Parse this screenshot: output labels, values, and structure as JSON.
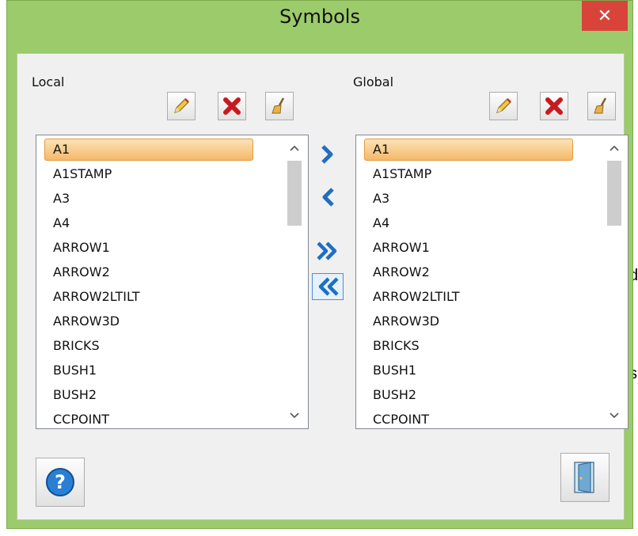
{
  "window": {
    "title": "Symbols",
    "close_glyph": "✕"
  },
  "background_fragments": {
    "line1": "d",
    "line2": "s"
  },
  "local": {
    "label": "Local",
    "toolbar": [
      "pencil-icon",
      "delete-x-icon",
      "broom-icon"
    ],
    "selected": "A1",
    "items": [
      "A1",
      "A1STAMP",
      "A3",
      "A4",
      "ARROW1",
      "ARROW2",
      "ARROW2LTILT",
      "ARROW3D",
      "BRICKS",
      "BUSH1",
      "BUSH2",
      "CCPOINT"
    ]
  },
  "global": {
    "label": "Global",
    "toolbar": [
      "pencil-icon",
      "delete-x-icon",
      "broom-icon"
    ],
    "selected": "A1",
    "items": [
      "A1",
      "A1STAMP",
      "A3",
      "A4",
      "ARROW1",
      "ARROW2",
      "ARROW2LTILT",
      "ARROW3D",
      "BRICKS",
      "BUSH1",
      "BUSH2",
      "CCPOINT"
    ]
  },
  "scrollbar": {
    "up_glyph": "^",
    "down_glyph": "v"
  },
  "transfer_buttons": [
    "copy-right-icon",
    "copy-left-icon",
    "copy-all-right-icon",
    "copy-all-left-icon"
  ],
  "footer": {
    "help": "help-icon",
    "exit": "exit-door-icon"
  },
  "colors": {
    "title_bar": "#9ccb6c",
    "close": "#d9443a",
    "selection": "#f4b96a",
    "arrow_blue": "#1e6fc2"
  }
}
